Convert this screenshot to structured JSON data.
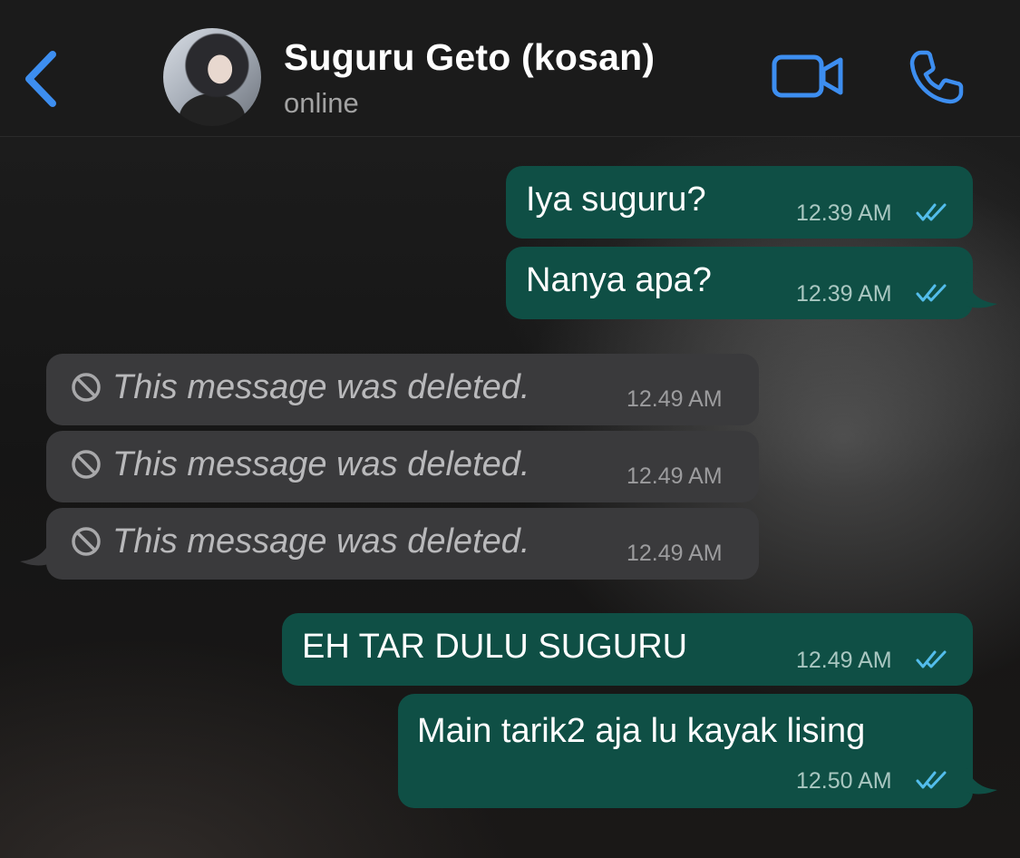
{
  "header": {
    "contact_name": "Suguru Geto (kosan)",
    "status": "online",
    "accent_color": "#3d8ef0"
  },
  "messages": [
    {
      "direction": "out",
      "text": "Iya suguru?",
      "time": "12.39 AM",
      "ticks": "read-double-check"
    },
    {
      "direction": "out",
      "text": "Nanya apa?",
      "time": "12.39 AM",
      "ticks": "read-double-check"
    },
    {
      "direction": "in",
      "text": "This message was deleted.",
      "time": "12.49 AM",
      "deleted": true
    },
    {
      "direction": "in",
      "text": "This message was deleted.",
      "time": "12.49 AM",
      "deleted": true
    },
    {
      "direction": "in",
      "text": "This message was deleted.",
      "time": "12.49 AM",
      "deleted": true
    },
    {
      "direction": "out",
      "text": "EH TAR DULU SUGURU",
      "time": "12.49 AM",
      "ticks": "read-double-check"
    },
    {
      "direction": "out",
      "text": "Main tarik2 aja lu kayak lising",
      "time": "12.50 AM",
      "ticks": "read-double-check"
    }
  ],
  "colors": {
    "outgoing_bubble": "#0f4f45",
    "incoming_bubble": "#3a3a3c",
    "read_ticks": "#53bdeb"
  },
  "icons": [
    "back-chevron-icon",
    "video-camera-icon",
    "phone-icon",
    "ban-icon",
    "double-check-icon"
  ]
}
